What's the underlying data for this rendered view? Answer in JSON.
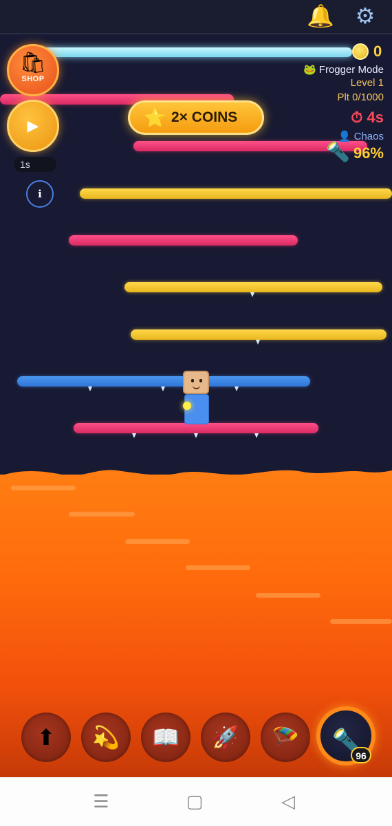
{
  "topbar": {
    "bell_icon": "bell-icon",
    "settings_icon": "gear-icon"
  },
  "left_controls": {
    "shop_label": "SHOP",
    "play_symbol": "▶",
    "elapsed": "1s",
    "info_symbol": "i"
  },
  "banner": {
    "text": "2× COINS",
    "star": "⭐"
  },
  "hud": {
    "coins": "0",
    "mode": "🐸 Frogger Mode",
    "level": "Level 1",
    "platforms": "Plt 0/1000",
    "timer": "⏱ 4s",
    "difficulty": "👤 Chaos",
    "flashlight_percent": "96%"
  },
  "powerups": [
    {
      "icon": "jump-arrow-icon",
      "glyph": "⬆",
      "active": false
    },
    {
      "icon": "shooting-star-icon",
      "glyph": "💫",
      "active": false
    },
    {
      "icon": "book-icon",
      "glyph": "📖",
      "active": false
    },
    {
      "icon": "rocket-icon",
      "glyph": "🚀",
      "active": false
    },
    {
      "icon": "parachute-icon",
      "glyph": "🪂",
      "active": false
    },
    {
      "icon": "flashlight-icon",
      "glyph": "🔦",
      "active": true,
      "count": "96"
    }
  ],
  "navbar": {
    "menu_glyph": "☰",
    "home_glyph": "▢",
    "back_glyph": "◁"
  },
  "colors": {
    "sky": "#181a33",
    "lava": "#ff6a0c",
    "accent": "#ffb020",
    "platform_yellow": "#f2c22a",
    "platform_pink": "#e83a74",
    "platform_blue": "#3a86e6",
    "platform_cyan": "#9fe6f6"
  }
}
